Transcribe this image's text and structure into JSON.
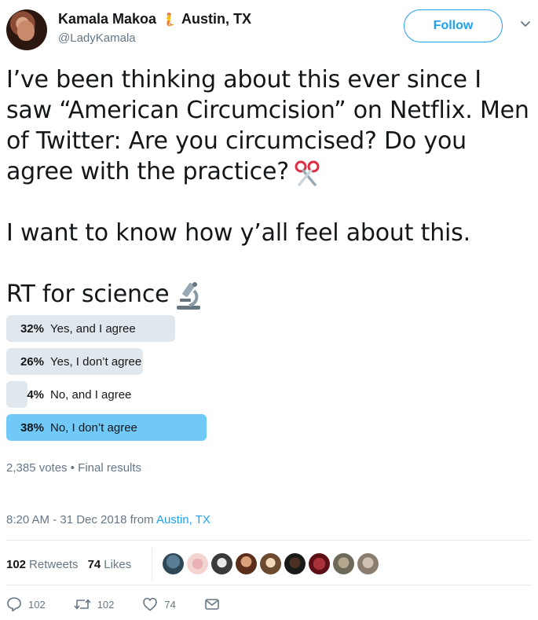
{
  "header": {
    "display_name": "Kamala Makoa",
    "name_emoji": "🧜",
    "location": "Austin, TX",
    "handle": "@LadyKamala",
    "follow_label": "Follow"
  },
  "tweet": {
    "line1": "I’ve been thinking about this ever since I saw “American Circumcision” on Netflix. Men of Twitter: Are you circumcised? Do you agree with the practice?",
    "line2": "I want to know how y’all feel about this.",
    "line3": "RT for science"
  },
  "poll": {
    "options": [
      {
        "pct": "32%",
        "label": "Yes, and I agree",
        "value": 32,
        "winner": false
      },
      {
        "pct": "26%",
        "label": "Yes, I don’t agree",
        "value": 26,
        "winner": false
      },
      {
        "pct": "4%",
        "label": "No, and I agree",
        "value": 4,
        "winner": false
      },
      {
        "pct": "38%",
        "label": "No, I don’t agree",
        "value": 38,
        "winner": true
      }
    ],
    "votes": "2,385 votes",
    "separator": "•",
    "status": "Final results"
  },
  "timestamp": {
    "time": "8:20 AM - 31 Dec 2018 from ",
    "place": "Austin, TX"
  },
  "stats": {
    "retweets_count": "102",
    "retweets_label": "Retweets",
    "likes_count": "74",
    "likes_label": "Likes"
  },
  "actions": {
    "reply_count": "102",
    "retweet_count": "102",
    "like_count": "74"
  },
  "colors": {
    "accent": "#1da1f2",
    "poll_winner": "#71c9f8",
    "poll_bar": "#e1e8ed"
  }
}
